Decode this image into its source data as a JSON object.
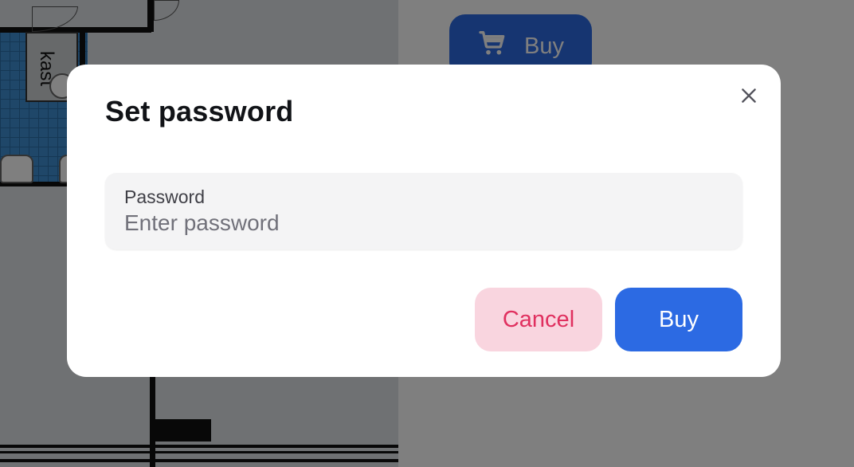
{
  "background": {
    "floorplan": {
      "closet_label": "kast"
    },
    "buy_button": {
      "label": "Buy",
      "icon": "shopping-cart-icon"
    }
  },
  "modal": {
    "title": "Set password",
    "close_icon": "close-icon",
    "password_field": {
      "label": "Password",
      "value": "",
      "placeholder": "Enter password"
    },
    "cancel_label": "Cancel",
    "buy_label": "Buy"
  },
  "colors": {
    "primary": "#2c6ae3",
    "danger_text": "#e0305f",
    "danger_bg": "#f9d5df",
    "input_bg": "#f4f4f5",
    "overlay": "rgba(0,0,0,0.5)"
  }
}
